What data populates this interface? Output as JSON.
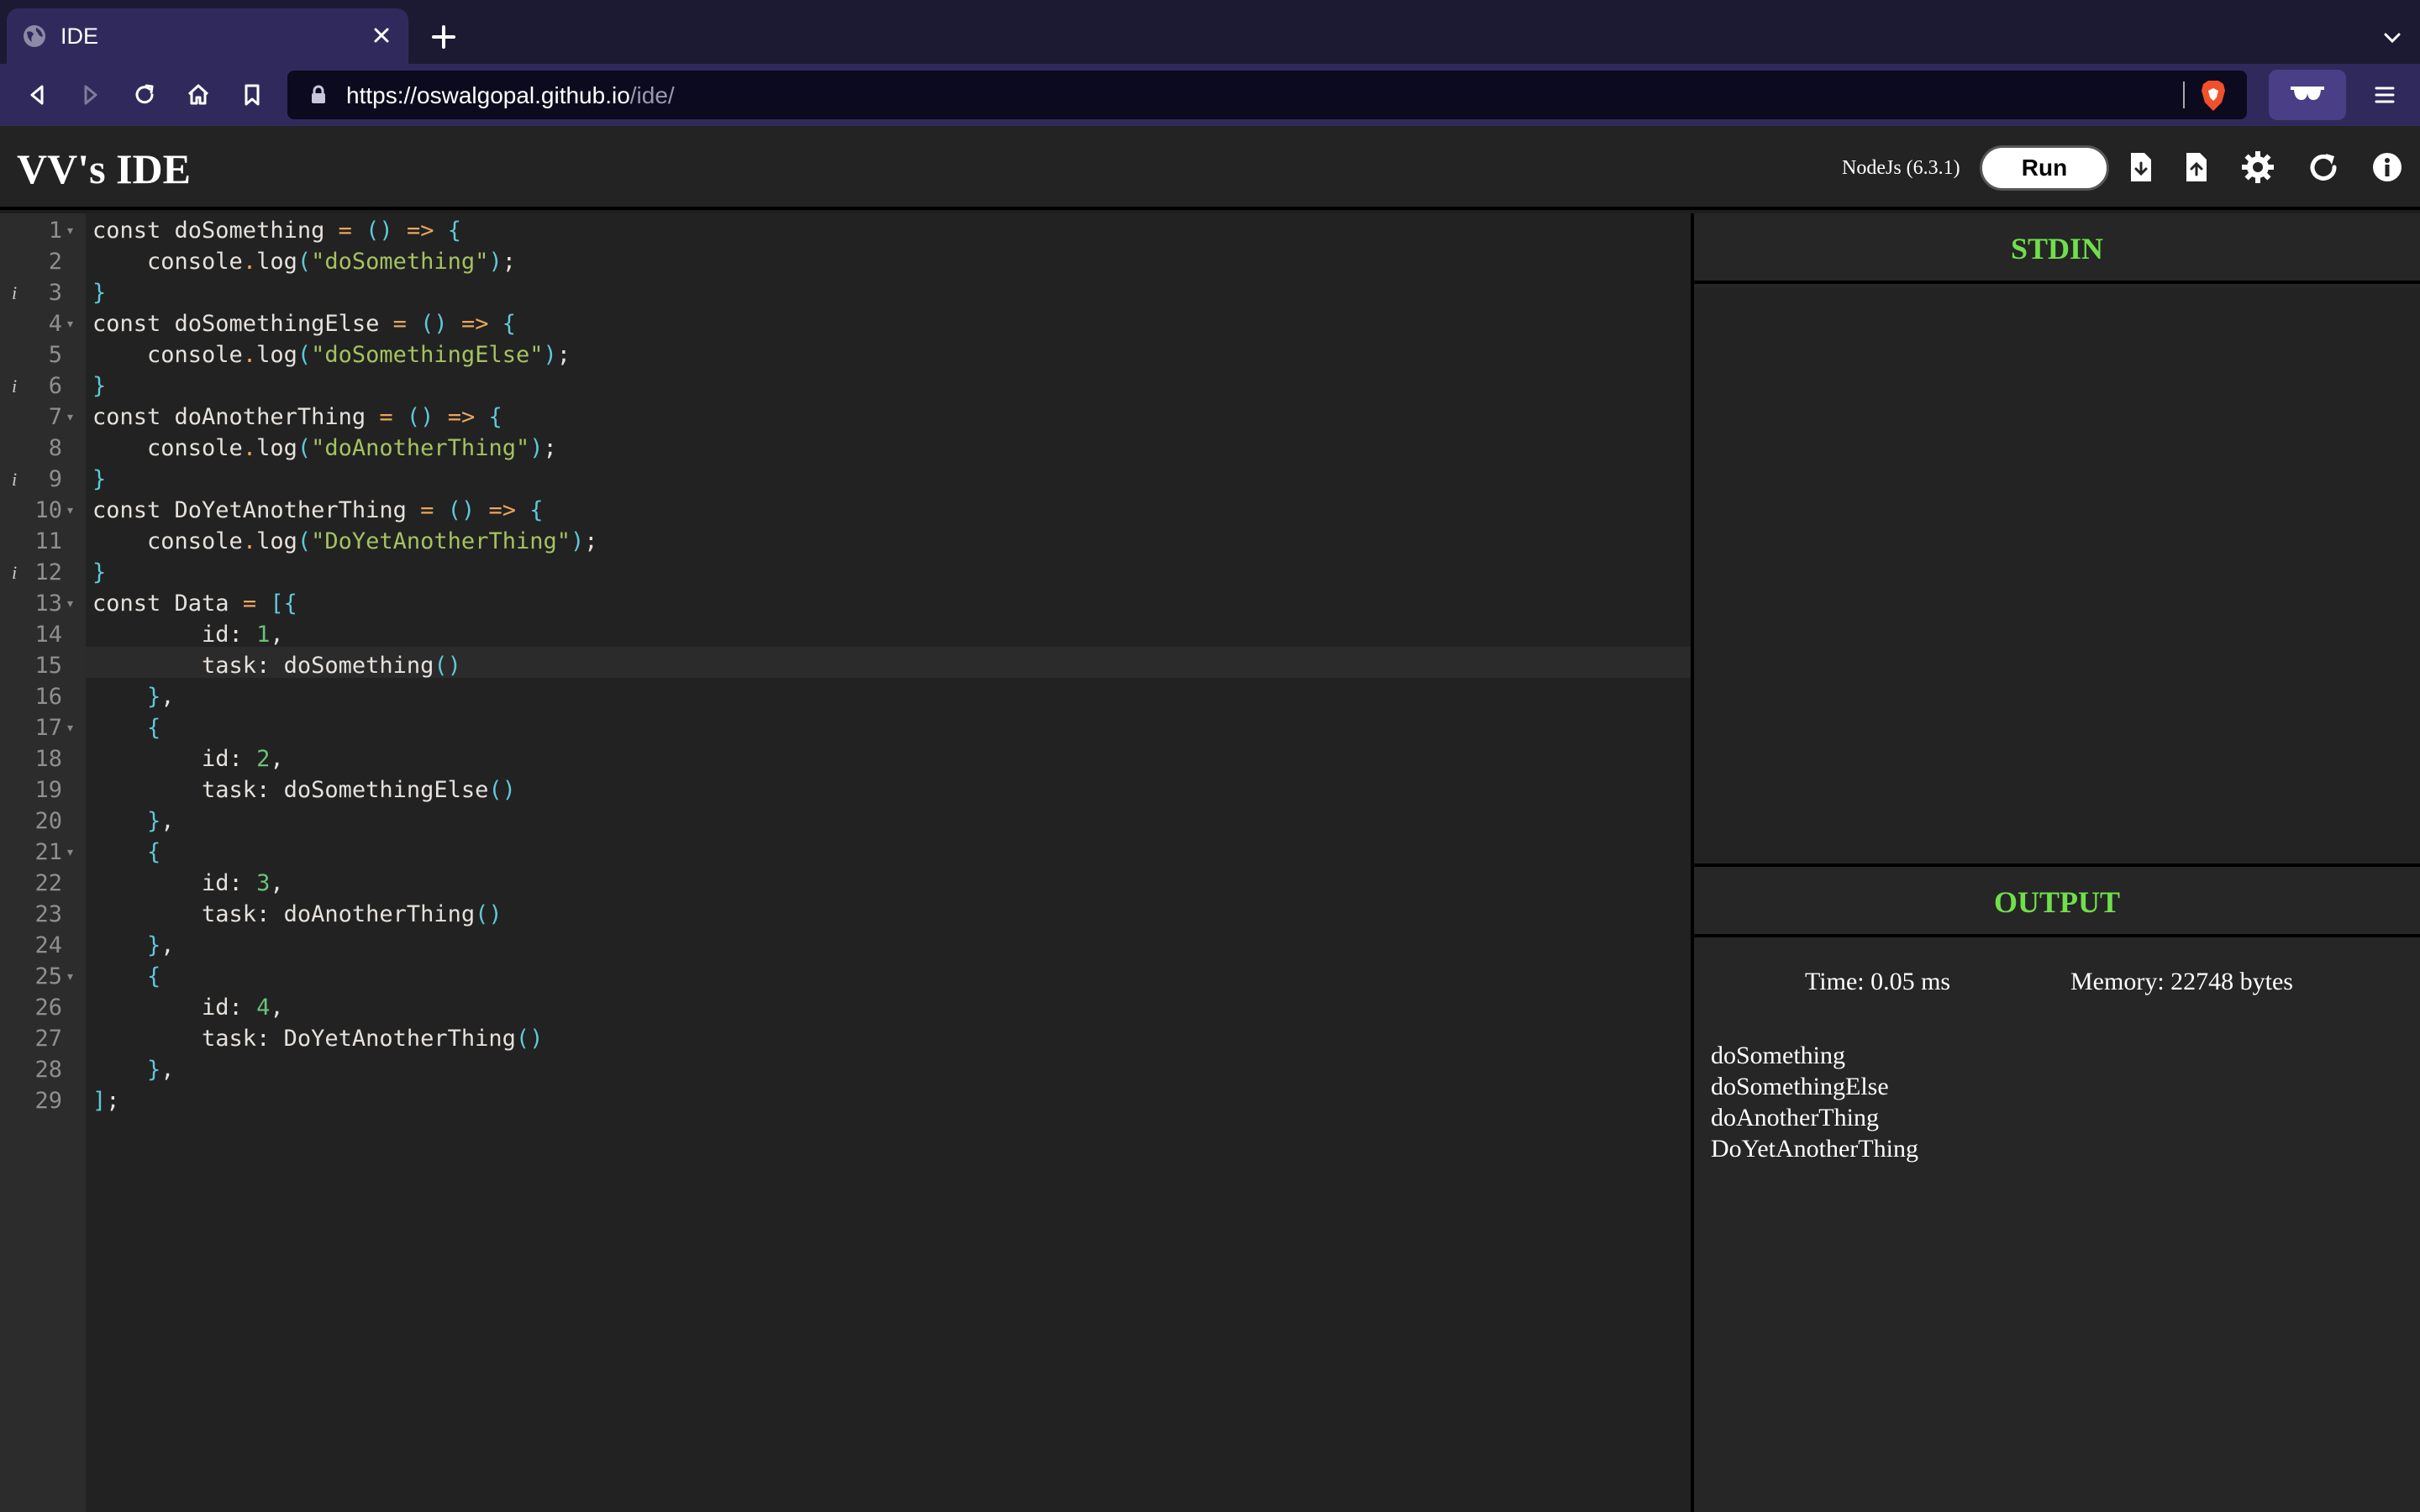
{
  "browser": {
    "tab_title": "IDE",
    "url_host": "https://oswalgopal.github.io",
    "url_path": "/ide/"
  },
  "app": {
    "title": "VV's IDE",
    "language": "NodeJs (6.3.1)",
    "run_label": "Run",
    "icons": [
      "download-icon",
      "upload-icon",
      "settings-gear-icon",
      "refresh-icon",
      "info-icon"
    ]
  },
  "editor": {
    "line_numbers": [
      "1",
      "2",
      "3",
      "4",
      "5",
      "6",
      "7",
      "8",
      "9",
      "10",
      "11",
      "12",
      "13",
      "14",
      "15",
      "16",
      "17",
      "18",
      "19",
      "20",
      "21",
      "22",
      "23",
      "24",
      "25",
      "26",
      "27",
      "28",
      "29"
    ],
    "folded_lines": [
      "1",
      "4",
      "7",
      "10",
      "13",
      "17",
      "21",
      "25"
    ],
    "annotated_lines": [
      "3",
      "6",
      "9",
      "12"
    ],
    "active_line": "15",
    "lines": [
      "const doSomething = () => {",
      "    console.log(\"doSomething\");",
      "}",
      "const doSomethingElse = () => {",
      "    console.log(\"doSomethingElse\");",
      "}",
      "const doAnotherThing = () => {",
      "    console.log(\"doAnotherThing\");",
      "}",
      "const DoYetAnotherThing = () => {",
      "    console.log(\"DoYetAnotherThing\");",
      "}",
      "const Data = [{",
      "        id: 1,",
      "        task: doSomething()",
      "    },",
      "    {",
      "        id: 2,",
      "        task: doSomethingElse()",
      "    },",
      "    {",
      "        id: 3,",
      "        task: doAnotherThing()",
      "    },",
      "    {",
      "        id: 4,",
      "        task: DoYetAnotherThing()",
      "    },",
      "];"
    ]
  },
  "stdin": {
    "heading": "STDIN",
    "value": ""
  },
  "output": {
    "heading": "OUTPUT",
    "time": "Time: 0.05 ms",
    "memory": "Memory: 22748 bytes",
    "lines": [
      "doSomething",
      "doSomethingElse",
      "doAnotherThing",
      "DoYetAnotherThing"
    ]
  },
  "colors": {
    "accent_green": "#6fe04b",
    "browser_toolbar": "#302a5c",
    "editor_bg": "#222222"
  }
}
